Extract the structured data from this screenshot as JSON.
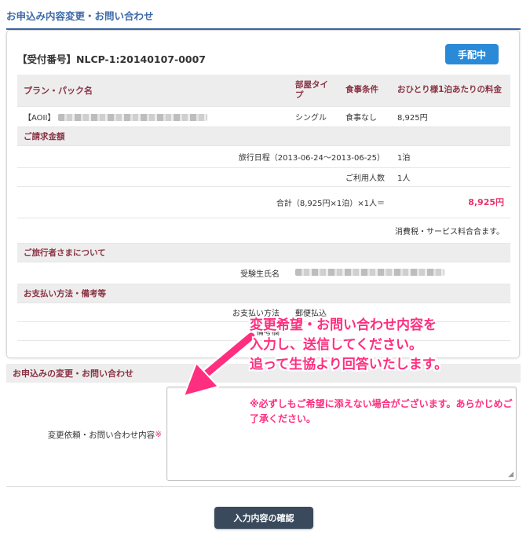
{
  "page_title": "お申込み内容変更・お問い合わせ",
  "reception": {
    "label": "【受付番号】",
    "number": "NLCP-1:20140107-0007",
    "status": "手配中",
    "status_color": "#2a8ad8"
  },
  "plan_table": {
    "headers": [
      "プラン・パック名",
      "部屋タイプ",
      "食事条件",
      "おひとり様1泊あたりの料金"
    ],
    "row": {
      "name_prefix": "【AOII】",
      "room_type": "シングル",
      "meal": "食事なし",
      "price": "8,925円"
    }
  },
  "billing": {
    "section_label": "ご請求金額",
    "dates_label": "旅行日程（2013-06-24〜2013-06-25）",
    "nights": "1泊",
    "people_label": "ご利用人数",
    "people": "1人",
    "total_label": "合計（8,925円×1泊）×1人＝",
    "total": "8,925円",
    "tax_note": "消費税・サービス料合合ます。",
    "accent_color": "#e8336b"
  },
  "traveler": {
    "section_label": "ご旅行者さまについて",
    "name_label": "受験生氏名"
  },
  "payment": {
    "section_label": "お支払い方法・備考等",
    "method_label": "お支払い方法",
    "method": "郵便払込",
    "remarks_label": "備考欄"
  },
  "inquiry": {
    "section_label": "お申込みの変更・お問い合わせ",
    "field_label": "変更依頼・お問い合わせ内容",
    "required_mark": "※"
  },
  "annotation": {
    "line1": "変更希望・お問い合わせ内容を",
    "line2": "入力し、送信してください。",
    "line3": "追って生協より回答いたします。",
    "sub1": "※必ずしもご希望に添えない場合がございます。あらかじめご了承ください。",
    "color": "#ff2e7f"
  },
  "submit_label": "入力内容の確認"
}
